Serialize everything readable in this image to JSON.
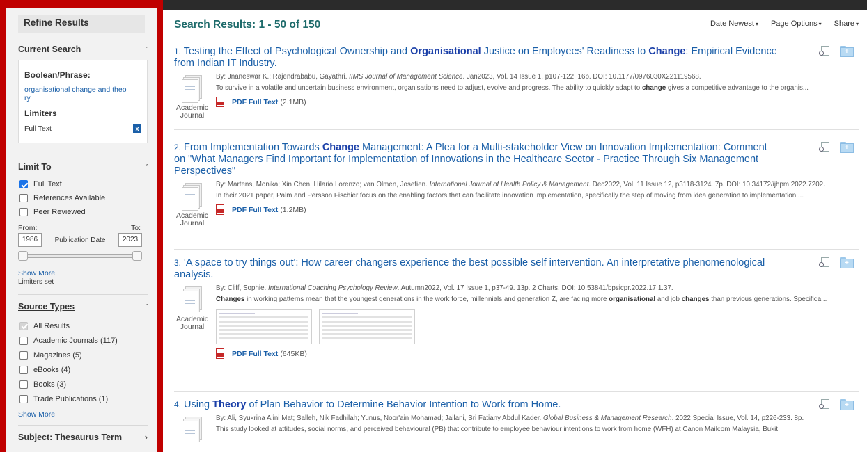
{
  "sidebar": {
    "refine_title": "Refine Results",
    "current_search": {
      "heading": "Current Search",
      "boolean_label": "Boolean/Phrase:",
      "term": "organisational change and theory",
      "limiters_label": "Limiters",
      "limiter_value": "Full Text",
      "remove_glyph": "x"
    },
    "limit_to": {
      "heading": "Limit To",
      "options": [
        {
          "label": "Full Text",
          "checked": true
        },
        {
          "label": "References Available",
          "checked": false
        },
        {
          "label": "Peer Reviewed",
          "checked": false
        }
      ],
      "from_label": "From:",
      "to_label": "To:",
      "from_value": "1986",
      "to_value": "2023",
      "pub_date_label": "Publication Date",
      "show_more": "Show More",
      "limiters_set": "Limiters set"
    },
    "source_types": {
      "heading": "Source Types",
      "options": [
        {
          "label": "All Results",
          "checked": true,
          "disabled": true
        },
        {
          "label": "Academic Journals (117)",
          "checked": false
        },
        {
          "label": "Magazines (5)",
          "checked": false
        },
        {
          "label": "eBooks (4)",
          "checked": false
        },
        {
          "label": "Books (3)",
          "checked": false
        },
        {
          "label": "Trade Publications (1)",
          "checked": false
        }
      ],
      "show_more": "Show More"
    },
    "subject_heading": "Subject: Thesaurus Term",
    "chevron_down": "ˇ",
    "chevron_right": "›"
  },
  "main": {
    "heading": "Search Results: 1 - 50 of 150",
    "options": [
      "Date Newest",
      "Page Options",
      "Share"
    ],
    "caret": "▾",
    "results": [
      {
        "num": "1.",
        "title_parts": [
          "Testing the Effect of Psychological Ownership and ",
          "Organisational",
          " Justice on Employees' Readiness to ",
          "Change",
          ": Empirical Evidence from Indian IT Industry."
        ],
        "by_plain": "By: Jnaneswar K.; Rajendrababu, Gayathri. ",
        "source": "IIMS Journal of Management Science",
        "by_tail": ". Jan2023, Vol. 14 Issue 1, p107-122. 16p. DOI: 10.1177/0976030X221119568.",
        "abs_parts": [
          "To survive in a volatile and uncertain business environment, organisations need to adjust, evolve and progress. The ability to quickly adapt to ",
          "change",
          " gives a competitive advantage to the organis..."
        ],
        "type": "Academic Journal",
        "pdf_label": "PDF Full Text",
        "pdf_size": "(2.1MB)"
      },
      {
        "num": "2.",
        "title_parts": [
          "From Implementation Towards ",
          "Change",
          " Management: A Plea for a Multi-stakeholder View on Innovation Implementation: Comment on \"What Managers Find Important for Implementation of Innovations in the Healthcare Sector - Practice Through Six Management Perspectives\""
        ],
        "by_plain": "By: Martens, Monika; Xin Chen, Hilario Lorenzo; van Olmen, Josefien. ",
        "source": "International Journal of Health Policy & Management",
        "by_tail": ". Dec2022, Vol. 11 Issue 12, p3118-3124. 7p. DOI: 10.34172/ijhpm.2022.7202.",
        "abs_parts": [
          "In their 2021 paper, Palm and Persson Fischier focus on the enabling factors that can facilitate innovation implementation, specifically the step of moving from idea generation to implementation ..."
        ],
        "type": "Academic Journal",
        "pdf_label": "PDF Full Text",
        "pdf_size": "(1.2MB)"
      },
      {
        "num": "3.",
        "title_parts": [
          "'A space to try things out': How career changers experience the best possible self intervention. An interpretative phenomenological analysis."
        ],
        "by_plain": "By: Cliff, Sophie. ",
        "source": "International Coaching Psychology Review",
        "by_tail": ". Autumn2022, Vol. 17 Issue 1, p37-49. 13p. 2 Charts. DOI: 10.53841/bpsicpr.2022.17.1.37.",
        "abs_parts": [
          "",
          "Changes",
          " in working patterns mean that the youngest generations in the work force, millennials and generation Z, are facing more ",
          "organisational",
          " and job ",
          "changes",
          " than previous generations. Specifica..."
        ],
        "type": "Academic Journal",
        "pdf_label": "PDF Full Text",
        "pdf_size": "(645KB)"
      },
      {
        "num": "4.",
        "title_parts": [
          "Using ",
          "Theory",
          " of Plan Behavior to Determine Behavior Intention to Work from Home."
        ],
        "by_plain": "By: Ali, Syukrina Alini Mat; Salleh, Nik Fadhilah; Yunus, Noor'ain Mohamad; Jailani, Sri Fatiany Abdul Kader. ",
        "source": "Global Business & Management Research",
        "by_tail": ". 2022 Special Issue, Vol. 14, p226-233. 8p.",
        "abs_parts": [
          "This study looked at attitudes, social norms, and perceived behavioural (PB) that contribute to employee behaviour intentions to work from home (WFH) at Canon Mailcom Malaysia, Bukit"
        ],
        "type": "",
        "pdf_label": "",
        "pdf_size": ""
      }
    ]
  }
}
